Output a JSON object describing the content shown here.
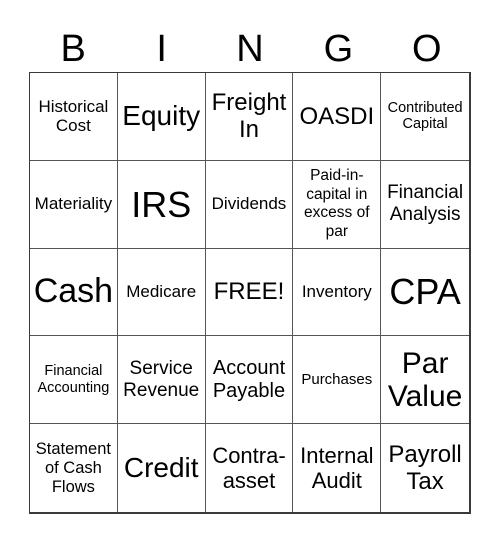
{
  "header": {
    "letters": [
      "B",
      "I",
      "N",
      "G",
      "O"
    ]
  },
  "board": {
    "rows": [
      [
        "Historical Cost",
        "Equity",
        "Freight In",
        "OASDI",
        "Contributed Capital"
      ],
      [
        "Materiality",
        "IRS",
        "Dividends",
        "Paid-in-capital in excess of par",
        "Financial Analysis"
      ],
      [
        "Cash",
        "Medicare",
        "FREE!",
        "Inventory",
        "CPA"
      ],
      [
        "Financial Accounting",
        "Service Revenue",
        "Account Payable",
        "Purchases",
        "Par Value"
      ],
      [
        "Statement of Cash Flows",
        "Credit",
        "Contra-asset",
        "Internal Audit",
        "Payroll Tax"
      ]
    ],
    "free_space": "FREE!"
  }
}
